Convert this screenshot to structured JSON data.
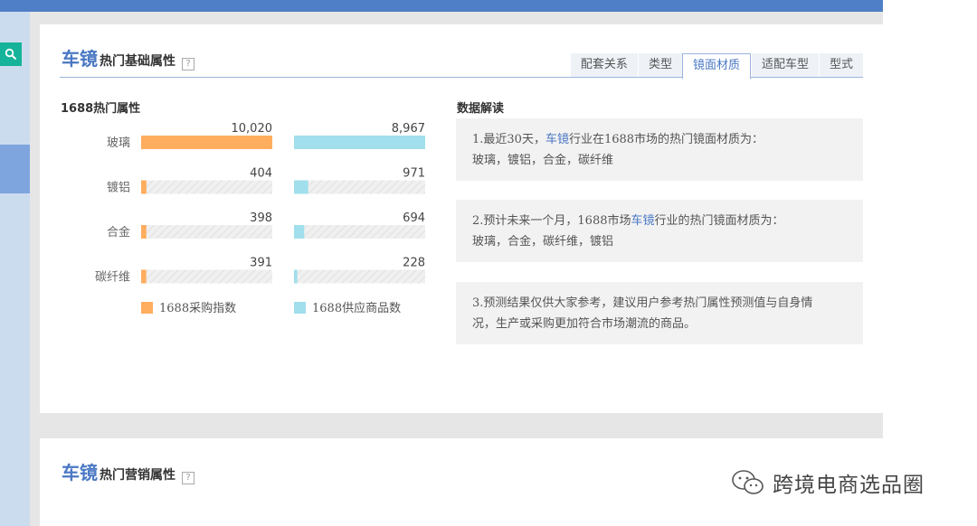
{
  "section1": {
    "title_main": "车镜",
    "title_sub": "热门基础属性",
    "help": "?"
  },
  "tabs": [
    "配套关系",
    "类型",
    "镜面材质",
    "适配车型",
    "型式"
  ],
  "active_tab": 2,
  "chart_title": "1688热门属性",
  "chart_data": {
    "type": "bar",
    "categories": [
      "玻璃",
      "镀铝",
      "合金",
      "碳纤维"
    ],
    "series": [
      {
        "name": "1688采购指数",
        "values": [
          10020,
          404,
          398,
          391
        ],
        "labels": [
          "10,020",
          "404",
          "398",
          "391"
        ],
        "color": "#ffad5f"
      },
      {
        "name": "1688供应商品数",
        "values": [
          8967,
          971,
          694,
          228
        ],
        "labels": [
          "8,967",
          "971",
          "694",
          "228"
        ],
        "color": "#a1dfec"
      }
    ]
  },
  "interpretation": {
    "title": "数据解读",
    "cards": [
      {
        "line1_pre": "1.最近30天，",
        "line1_hl": "车镜",
        "line1_post": "行业在1688市场的热门镜面材质为：",
        "line2": "玻璃，镀铝，合金，碳纤维"
      },
      {
        "line1_pre": "2.预计未来一个月，1688市场",
        "line1_hl": "车镜",
        "line1_post": "行业的热门镜面材质为：",
        "line2": "玻璃，合金，碳纤维，镀铝"
      },
      {
        "line1_pre": "3.预测结果仅供大家参考，建议用户参考热门属性预测值与自身情",
        "line1_hl": "",
        "line1_post": "",
        "line2": "况，生产或采购更加符合市场潮流的商品。"
      }
    ]
  },
  "section2": {
    "title_main": "车镜",
    "title_sub": "热门营销属性",
    "help": "?"
  },
  "watermark": {
    "text": "跨境电商选品圈"
  },
  "colors": {
    "accent": "#4a78c4",
    "purchase": "#ffad5f",
    "supply": "#a1dfec",
    "nav": "#4f7fc6"
  }
}
